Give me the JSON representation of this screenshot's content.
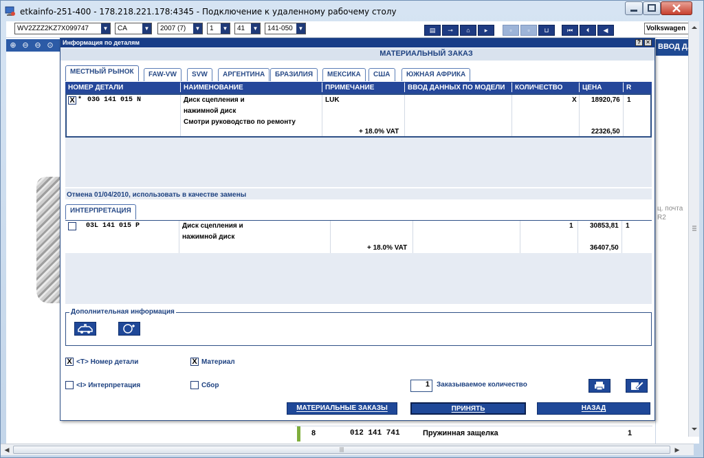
{
  "window": {
    "title": "etkainfo-251-400 - 178.218.221.178:4345 - Подключение к удаленному рабочему столу"
  },
  "toolbar": {
    "vin": "WV2ZZZ2KZ7X099747",
    "market": "CA",
    "year": "2007 (7)",
    "main_group": "1",
    "sub_group": "41",
    "part_group": "141-050",
    "brand": "Volkswagen"
  },
  "right_panel": {
    "header": "ВВОД ДАННЫ",
    "note_line1": "ц. почта",
    "note_line2": "R2"
  },
  "background_row": {
    "pos": "8",
    "part": "012 141 741",
    "name": "Пружинная защелка",
    "qty": "1"
  },
  "dialog": {
    "title": "Информация по деталям",
    "header": "МАТЕРИАЛЬНЫЙ ЗАКАЗ",
    "tabs": [
      "МЕСТНЫЙ РЫНОК",
      "FAW-VW",
      "SVW",
      "АРГЕНТИНА",
      "БРАЗИЛИЯ",
      "МЕКСИКА",
      "США",
      "ЮЖНАЯ АФРИКА"
    ],
    "columns": {
      "part_no": "НОМЕР ДЕТАЛИ",
      "name": "НАИМЕНОВАНИЕ",
      "note": "ПРИМЕЧАНИЕ",
      "model_input": "ВВОД ДАННЫХ ПО МОДЕЛИ",
      "qty": "КОЛИЧЕСТВО",
      "price": "ЦЕНА",
      "r": "R"
    },
    "row1": {
      "checked": "X",
      "prefix": "*",
      "part_no": "03G 141 015 N",
      "name_line1": "Диск сцепления и",
      "name_line2": "нажимной диск",
      "name_line3": "Смотри руководство по ремонту",
      "note": "LUK",
      "vat": "+ 18.0% VAT",
      "qty": "X",
      "price": "18920,76",
      "price_vat": "22326,50",
      "r": "1"
    },
    "replace_note": "Отмена 01/04/2010, использовать в качестве замены",
    "interp_tab": "ИНТЕРПРЕТАЦИЯ",
    "row2": {
      "part_no": "03L 141 015 P",
      "name_line1": "Диск сцепления и",
      "name_line2": "нажимной диск",
      "vat": "+ 18.0% VAT",
      "qty": "1",
      "price": "30853,81",
      "price_vat": "36407,50",
      "r": "1"
    },
    "addinfo_label": "Дополнительная информация",
    "options": {
      "part_no": "<T> Номер детали",
      "material": "Материал",
      "interpretation": "<I> Интерпретация",
      "assembly": "Сбор",
      "order_qty_label": "Заказываемое количество",
      "order_qty": "1",
      "checked_mark": "X"
    },
    "buttons": {
      "material_orders": "МАТЕРИАЛЬНЫЕ ЗАКАЗЫ",
      "accept": "ПРИНЯТЬ",
      "back": "НАЗАД"
    }
  },
  "colors": {
    "navy": "#25479a",
    "accent_text": "#1d4180",
    "panel_bg": "#e6ebf3"
  }
}
